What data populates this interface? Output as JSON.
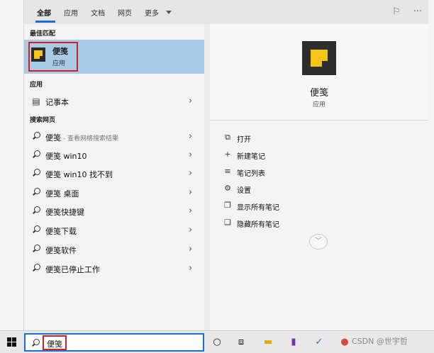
{
  "tabs": [
    "全部",
    "应用",
    "文档",
    "网页",
    "更多"
  ],
  "best_match": {
    "title": "最佳匹配",
    "name": "便笺",
    "subtitle": "应用"
  },
  "apps": {
    "title": "应用",
    "items": [
      {
        "label": "记事本"
      }
    ]
  },
  "web": {
    "title": "搜索网页",
    "items": [
      {
        "label": "便笺",
        "suffix": " - 查看网络搜索结果"
      },
      {
        "label": "便笺 win10"
      },
      {
        "label": "便笺 win10 找不到"
      },
      {
        "label": "便笺 桌面"
      },
      {
        "label": "便笺快捷键"
      },
      {
        "label": "便笺下载"
      },
      {
        "label": "便笺软件"
      },
      {
        "label": "便笺已停止工作"
      }
    ]
  },
  "preview": {
    "title": "便笺",
    "subtitle": "应用",
    "actions": [
      {
        "label": "打开",
        "icon": "open-icon"
      },
      {
        "label": "新建笔记",
        "icon": "plus-icon"
      },
      {
        "label": "笔记列表",
        "icon": "list-icon"
      },
      {
        "label": "设置",
        "icon": "gear-icon"
      },
      {
        "label": "显示所有笔记",
        "icon": "show-notes-icon"
      },
      {
        "label": "隐藏所有笔记",
        "icon": "hide-notes-icon"
      }
    ]
  },
  "taskbar": {
    "search_value": "便笺",
    "watermark": "CSDN @世宇哲"
  },
  "colors": {
    "accent": "#1a6fd0",
    "highlight": "#a8cbe8",
    "annotation_red": "#d32020",
    "sticky_yellow": "#f5c518"
  }
}
